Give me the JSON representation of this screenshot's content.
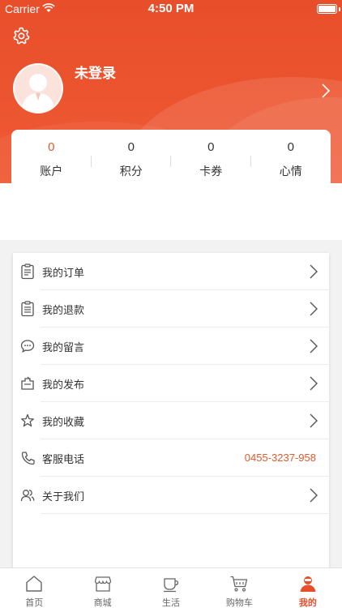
{
  "status_bar": {
    "carrier": "Carrier",
    "time": "4:50 PM"
  },
  "profile": {
    "name": "未登录"
  },
  "stats": [
    {
      "value": "0",
      "label": "账户"
    },
    {
      "value": "0",
      "label": "积分"
    },
    {
      "value": "0",
      "label": "卡券"
    },
    {
      "value": "0",
      "label": "心情"
    }
  ],
  "menu": [
    {
      "label": "我的订单",
      "icon": "order-icon"
    },
    {
      "label": "我的退款",
      "icon": "refund-icon"
    },
    {
      "label": "我的留言",
      "icon": "message-icon"
    },
    {
      "label": "我的发布",
      "icon": "publish-icon"
    },
    {
      "label": "我的收藏",
      "icon": "star-icon"
    },
    {
      "label": "客服电话",
      "icon": "phone-icon",
      "value": "0455-3237-958"
    },
    {
      "label": "关于我们",
      "icon": "people-icon"
    }
  ],
  "tabs": [
    {
      "label": "首页",
      "icon": "home-icon"
    },
    {
      "label": "商城",
      "icon": "shop-icon"
    },
    {
      "label": "生活",
      "icon": "cup-icon"
    },
    {
      "label": "购物车",
      "icon": "cart-icon"
    },
    {
      "label": "我的",
      "icon": "user-icon",
      "active": true
    }
  ],
  "colors": {
    "accent": "#e84e2a",
    "highlight": "#e05a2c"
  }
}
